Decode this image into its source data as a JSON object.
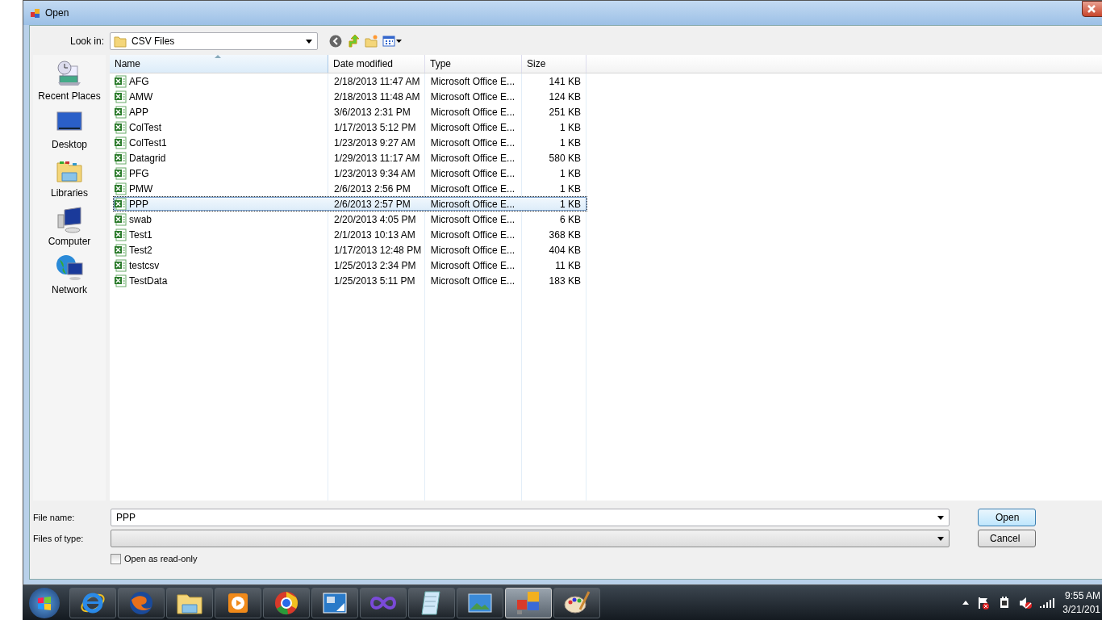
{
  "window": {
    "title": "Open"
  },
  "look_in": {
    "label": "Look in:",
    "value": "CSV Files"
  },
  "places": [
    {
      "label": "Recent Places",
      "kind": "recent"
    },
    {
      "label": "Desktop",
      "kind": "desktop"
    },
    {
      "label": "Libraries",
      "kind": "libraries"
    },
    {
      "label": "Computer",
      "kind": "computer"
    },
    {
      "label": "Network",
      "kind": "network"
    }
  ],
  "file_list": {
    "columns": [
      {
        "label": "Name",
        "sorted": true
      },
      {
        "label": "Date modified",
        "sorted": false
      },
      {
        "label": "Type",
        "sorted": false
      },
      {
        "label": "Size",
        "sorted": false
      }
    ],
    "rows": [
      {
        "name": "AFG",
        "date": "2/18/2013 11:47 AM",
        "type": "Microsoft Office E...",
        "size": "141 KB",
        "selected": false
      },
      {
        "name": "AMW",
        "date": "2/18/2013 11:48 AM",
        "type": "Microsoft Office E...",
        "size": "124 KB",
        "selected": false
      },
      {
        "name": "APP",
        "date": "3/6/2013 2:31 PM",
        "type": "Microsoft Office E...",
        "size": "251 KB",
        "selected": false
      },
      {
        "name": "ColTest",
        "date": "1/17/2013 5:12 PM",
        "type": "Microsoft Office E...",
        "size": "1 KB",
        "selected": false
      },
      {
        "name": "ColTest1",
        "date": "1/23/2013 9:27 AM",
        "type": "Microsoft Office E...",
        "size": "1 KB",
        "selected": false
      },
      {
        "name": "Datagrid",
        "date": "1/29/2013 11:17 AM",
        "type": "Microsoft Office E...",
        "size": "580 KB",
        "selected": false
      },
      {
        "name": "PFG",
        "date": "1/23/2013 9:34 AM",
        "type": "Microsoft Office E...",
        "size": "1 KB",
        "selected": false
      },
      {
        "name": "PMW",
        "date": "2/6/2013 2:56 PM",
        "type": "Microsoft Office E...",
        "size": "1 KB",
        "selected": false
      },
      {
        "name": "PPP",
        "date": "2/6/2013 2:57 PM",
        "type": "Microsoft Office E...",
        "size": "1 KB",
        "selected": true
      },
      {
        "name": "swab",
        "date": "2/20/2013 4:05 PM",
        "type": "Microsoft Office E...",
        "size": "6 KB",
        "selected": false
      },
      {
        "name": "Test1",
        "date": "2/1/2013 10:13 AM",
        "type": "Microsoft Office E...",
        "size": "368 KB",
        "selected": false
      },
      {
        "name": "Test2",
        "date": "1/17/2013 12:48 PM",
        "type": "Microsoft Office E...",
        "size": "404 KB",
        "selected": false
      },
      {
        "name": "testcsv",
        "date": "1/25/2013 2:34 PM",
        "type": "Microsoft Office E...",
        "size": "11 KB",
        "selected": false
      },
      {
        "name": "TestData",
        "date": "1/25/2013 5:11 PM",
        "type": "Microsoft Office E...",
        "size": "183 KB",
        "selected": false
      }
    ]
  },
  "file_name": {
    "label": "File name:",
    "value": "PPP"
  },
  "file_type": {
    "label": "Files of type:"
  },
  "read_only": {
    "label": "Open as read-only",
    "checked": false
  },
  "buttons": [
    {
      "label": "Open",
      "default": true
    },
    {
      "label": "Cancel",
      "default": false
    }
  ],
  "taskbar": {
    "apps": [
      {
        "kind": "browser-e",
        "active": false
      },
      {
        "kind": "browser-fox",
        "active": false
      },
      {
        "kind": "folder",
        "active": false
      },
      {
        "kind": "media",
        "active": false
      },
      {
        "kind": "browser-ring",
        "active": false
      },
      {
        "kind": "remote",
        "active": false
      },
      {
        "kind": "infinity",
        "active": false
      },
      {
        "kind": "notepad",
        "active": false
      },
      {
        "kind": "picture",
        "active": false
      },
      {
        "kind": "squares",
        "active": true
      },
      {
        "kind": "palette",
        "active": false
      }
    ],
    "clock": {
      "time": "9:55 AM",
      "date": "3/21/201"
    }
  }
}
